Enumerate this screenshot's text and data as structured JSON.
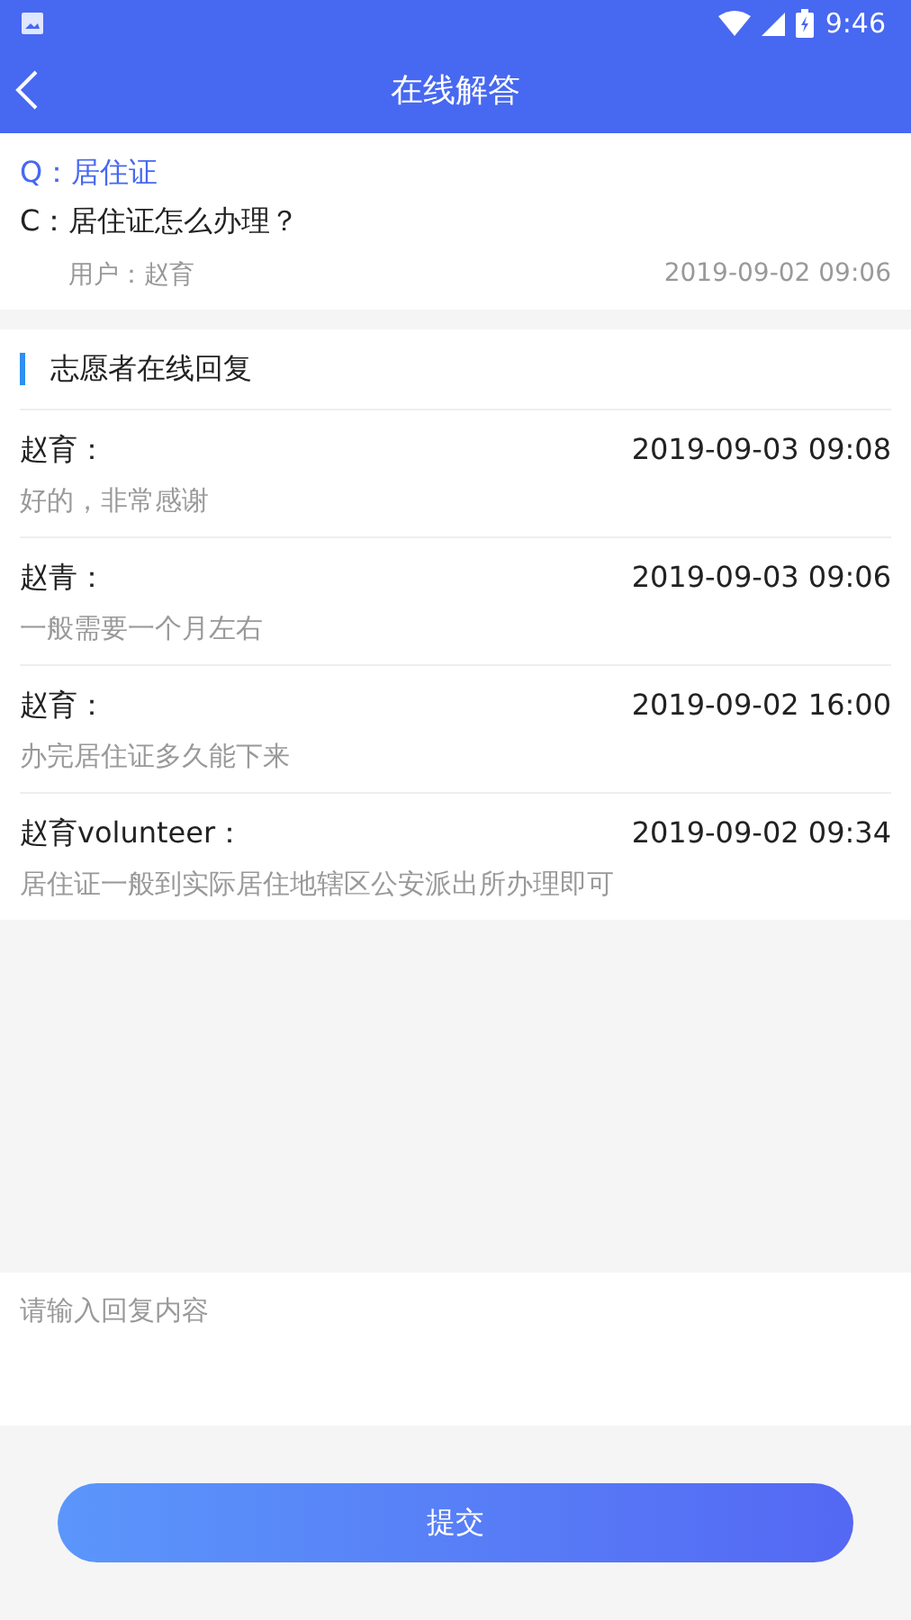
{
  "status_bar": {
    "time": "9:46"
  },
  "header": {
    "title": "在线解答"
  },
  "question": {
    "q": "Q：居住证",
    "c": "C：居住证怎么办理？",
    "user": "用户：赵育",
    "time": "2019-09-02 09:06"
  },
  "replies": {
    "title": "志愿者在线回复",
    "items": [
      {
        "name": "赵育：",
        "time": "2019-09-03 09:08",
        "text": "好的，非常感谢"
      },
      {
        "name": "赵青：",
        "time": "2019-09-03 09:06",
        "text": "一般需要一个月左右"
      },
      {
        "name": "赵育：",
        "time": "2019-09-02 16:00",
        "text": "办完居住证多久能下来"
      },
      {
        "name": "赵育volunteer：",
        "time": "2019-09-02 09:34",
        "text": "居住证一般到实际居住地辖区公安派出所办理即可"
      }
    ]
  },
  "reply_input": {
    "placeholder": "请输入回复内容"
  },
  "submit_button": "提交"
}
